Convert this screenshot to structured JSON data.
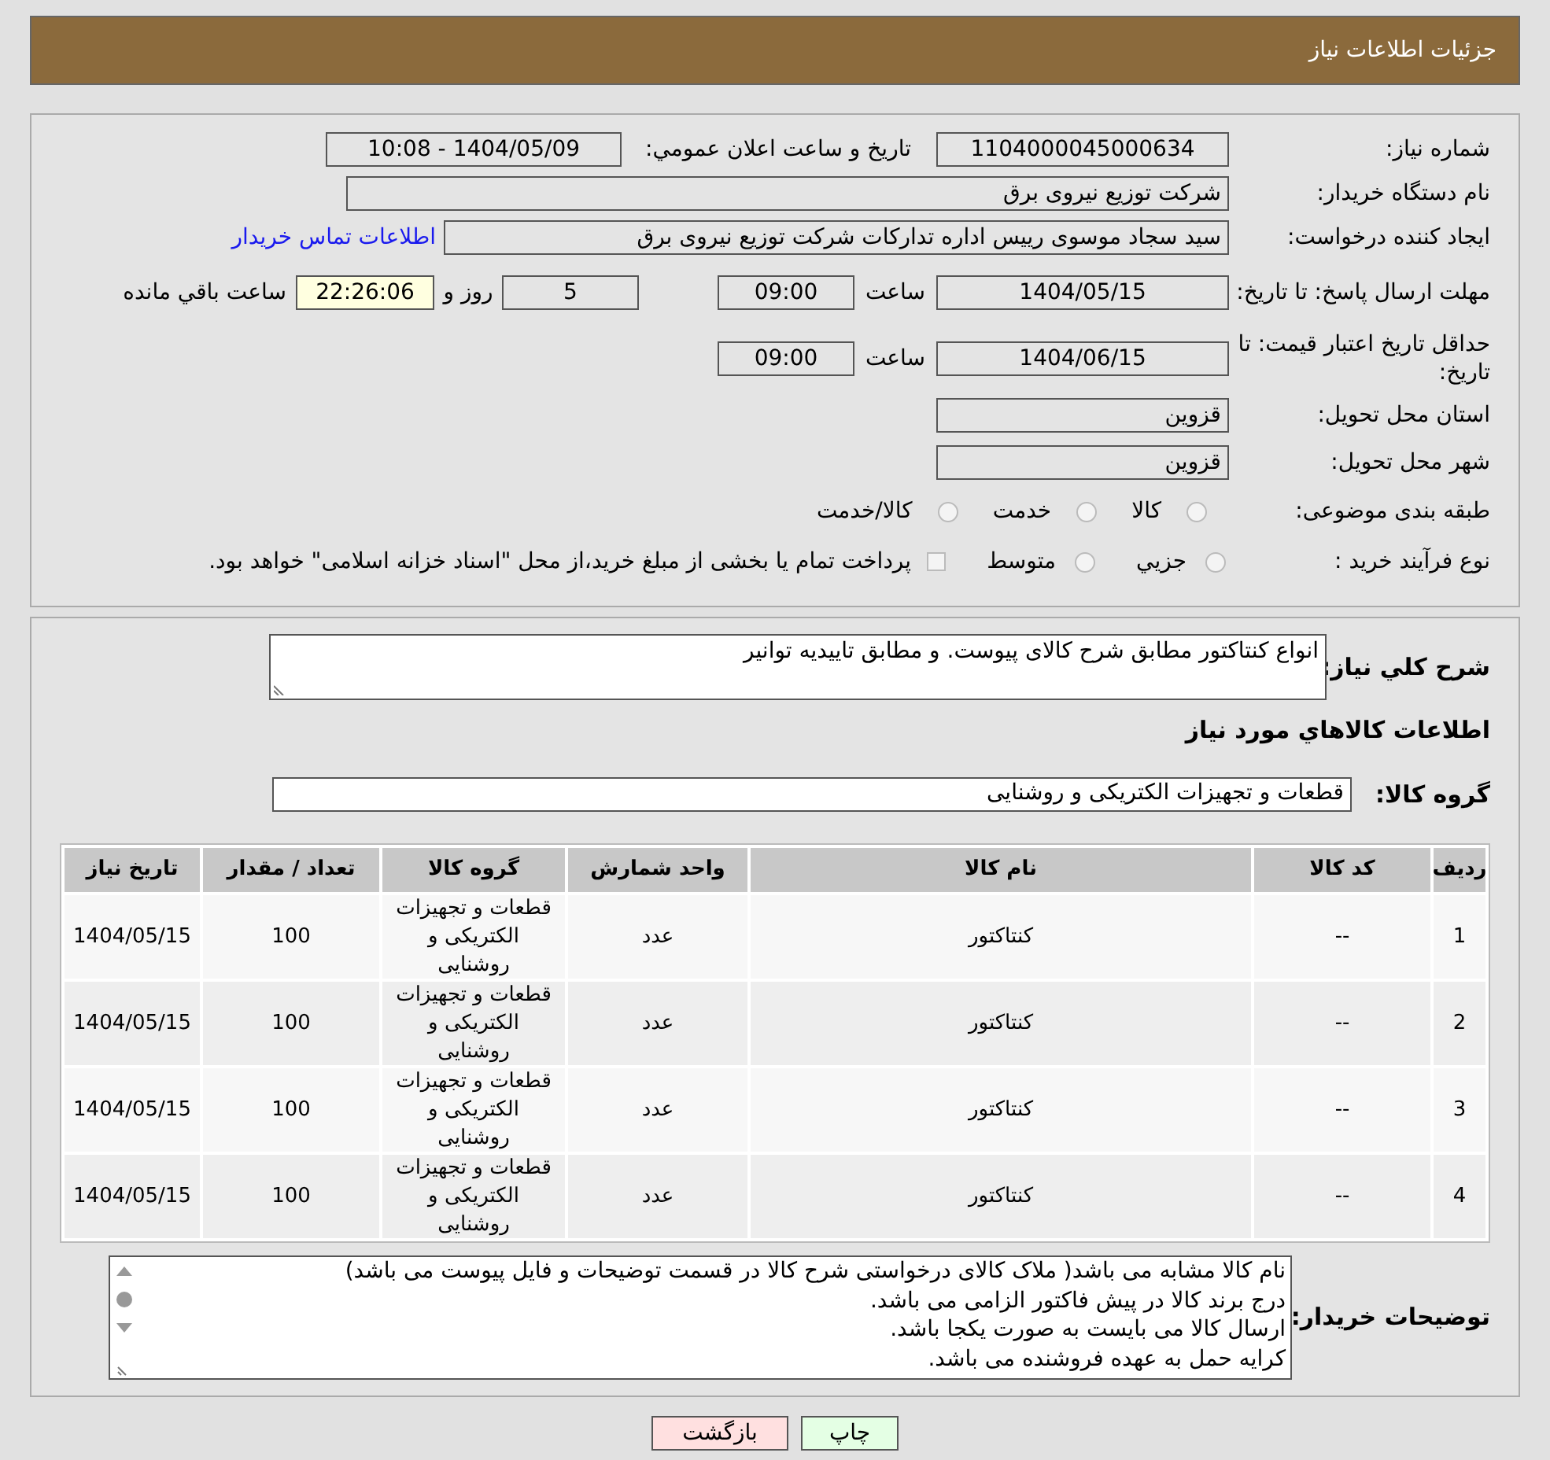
{
  "header": {
    "title": "جزئیات اطلاعات نیاز"
  },
  "need_number": {
    "label": "شماره نیاز:",
    "value": "1104000045000634"
  },
  "announce_date": {
    "label": "تاريخ و ساعت اعلان عمومي:",
    "value": "1404/05/09 - 10:08"
  },
  "buyer_org": {
    "label": "نام دستگاه خریدار:",
    "value": "شرکت توزیع نیروی برق"
  },
  "requester": {
    "label": "ایجاد کننده درخواست:",
    "value": "سید سجاد موسوی رییس اداره تدارکات شرکت توزیع نیروی برق",
    "link": "اطلاعات تماس خریدار"
  },
  "deadline": {
    "label": "مهلت ارسال پاسخ: تا تاریخ:",
    "date": "1404/05/15",
    "time_label": "ساعت",
    "time": "09:00",
    "days": "5",
    "days_label": "روز و",
    "remaining": "22:26:06",
    "remaining_label": "ساعت باقي مانده"
  },
  "price_validity": {
    "label": "حداقل تاریخ اعتبار قیمت: تا تاریخ:",
    "date": "1404/06/15",
    "time_label": "ساعت",
    "time": "09:00"
  },
  "province": {
    "label": "استان محل تحویل:",
    "value": "قزوین"
  },
  "city": {
    "label": "شهر محل تحویل:",
    "value": "قزوین"
  },
  "category": {
    "label": "طبقه بندی موضوعی:",
    "options": [
      {
        "label": "کالا",
        "selected": false
      },
      {
        "label": "خدمت",
        "selected": false
      },
      {
        "label": "کالا/خدمت",
        "selected": false
      }
    ]
  },
  "process": {
    "label": "نوع فرآیند خرید :",
    "options": [
      {
        "label": "جزيي",
        "selected": false
      },
      {
        "label": "متوسط",
        "selected": false
      }
    ],
    "payment": {
      "label": "پرداخت تمام یا بخشی از مبلغ خرید،از محل \"اسناد خزانه اسلامی\" خواهد بود.",
      "checked": false
    }
  },
  "description": {
    "label": "شرح کلي نیاز:",
    "value": "انواع کنتاکتور مطابق شرح کالای پیوست. و مطابق تاییدیه توانیر"
  },
  "goods_heading": "اطلاعات کالاهاي مورد نیاز",
  "goods_group": {
    "label": "گروه کالا:",
    "value": "قطعات و تجهیزات الکتریکی و روشنایی"
  },
  "table": {
    "columns": [
      "ردیف",
      "کد کالا",
      "نام کالا",
      "واحد شمارش",
      "گروه کالا",
      "تعداد / مقدار",
      "تاریخ نیاز"
    ],
    "rows": [
      [
        "1",
        "--",
        "کنتاکتور",
        "عدد",
        "قطعات و تجهیزات الکتریکی و روشنایی",
        "100",
        "1404/05/15"
      ],
      [
        "2",
        "--",
        "کنتاکتور",
        "عدد",
        "قطعات و تجهیزات الکتریکی و روشنایی",
        "100",
        "1404/05/15"
      ],
      [
        "3",
        "--",
        "کنتاکتور",
        "عدد",
        "قطعات و تجهیزات الکتریکی و روشنایی",
        "100",
        "1404/05/15"
      ],
      [
        "4",
        "--",
        "کنتاکتور",
        "عدد",
        "قطعات و تجهیزات الکتریکی و روشنایی",
        "100",
        "1404/05/15"
      ]
    ]
  },
  "buyer_notes": {
    "label": "توضیحات خریدار:",
    "lines": [
      "نام کالا مشابه می باشد( ملاک کالای درخواستی شرح کالا در قسمت توضیحات و فایل پیوست می باشد)",
      "درج برند کالا در پیش فاکتور الزامی می باشد.",
      "ارسال کالا می بایست به صورت یکجا باشد.",
      "کرایه حمل به عهده فروشنده می باشد."
    ]
  },
  "buttons": [
    {
      "label": "چاپ",
      "kind": "print"
    },
    {
      "label": "بازگشت",
      "kind": "back"
    }
  ]
}
